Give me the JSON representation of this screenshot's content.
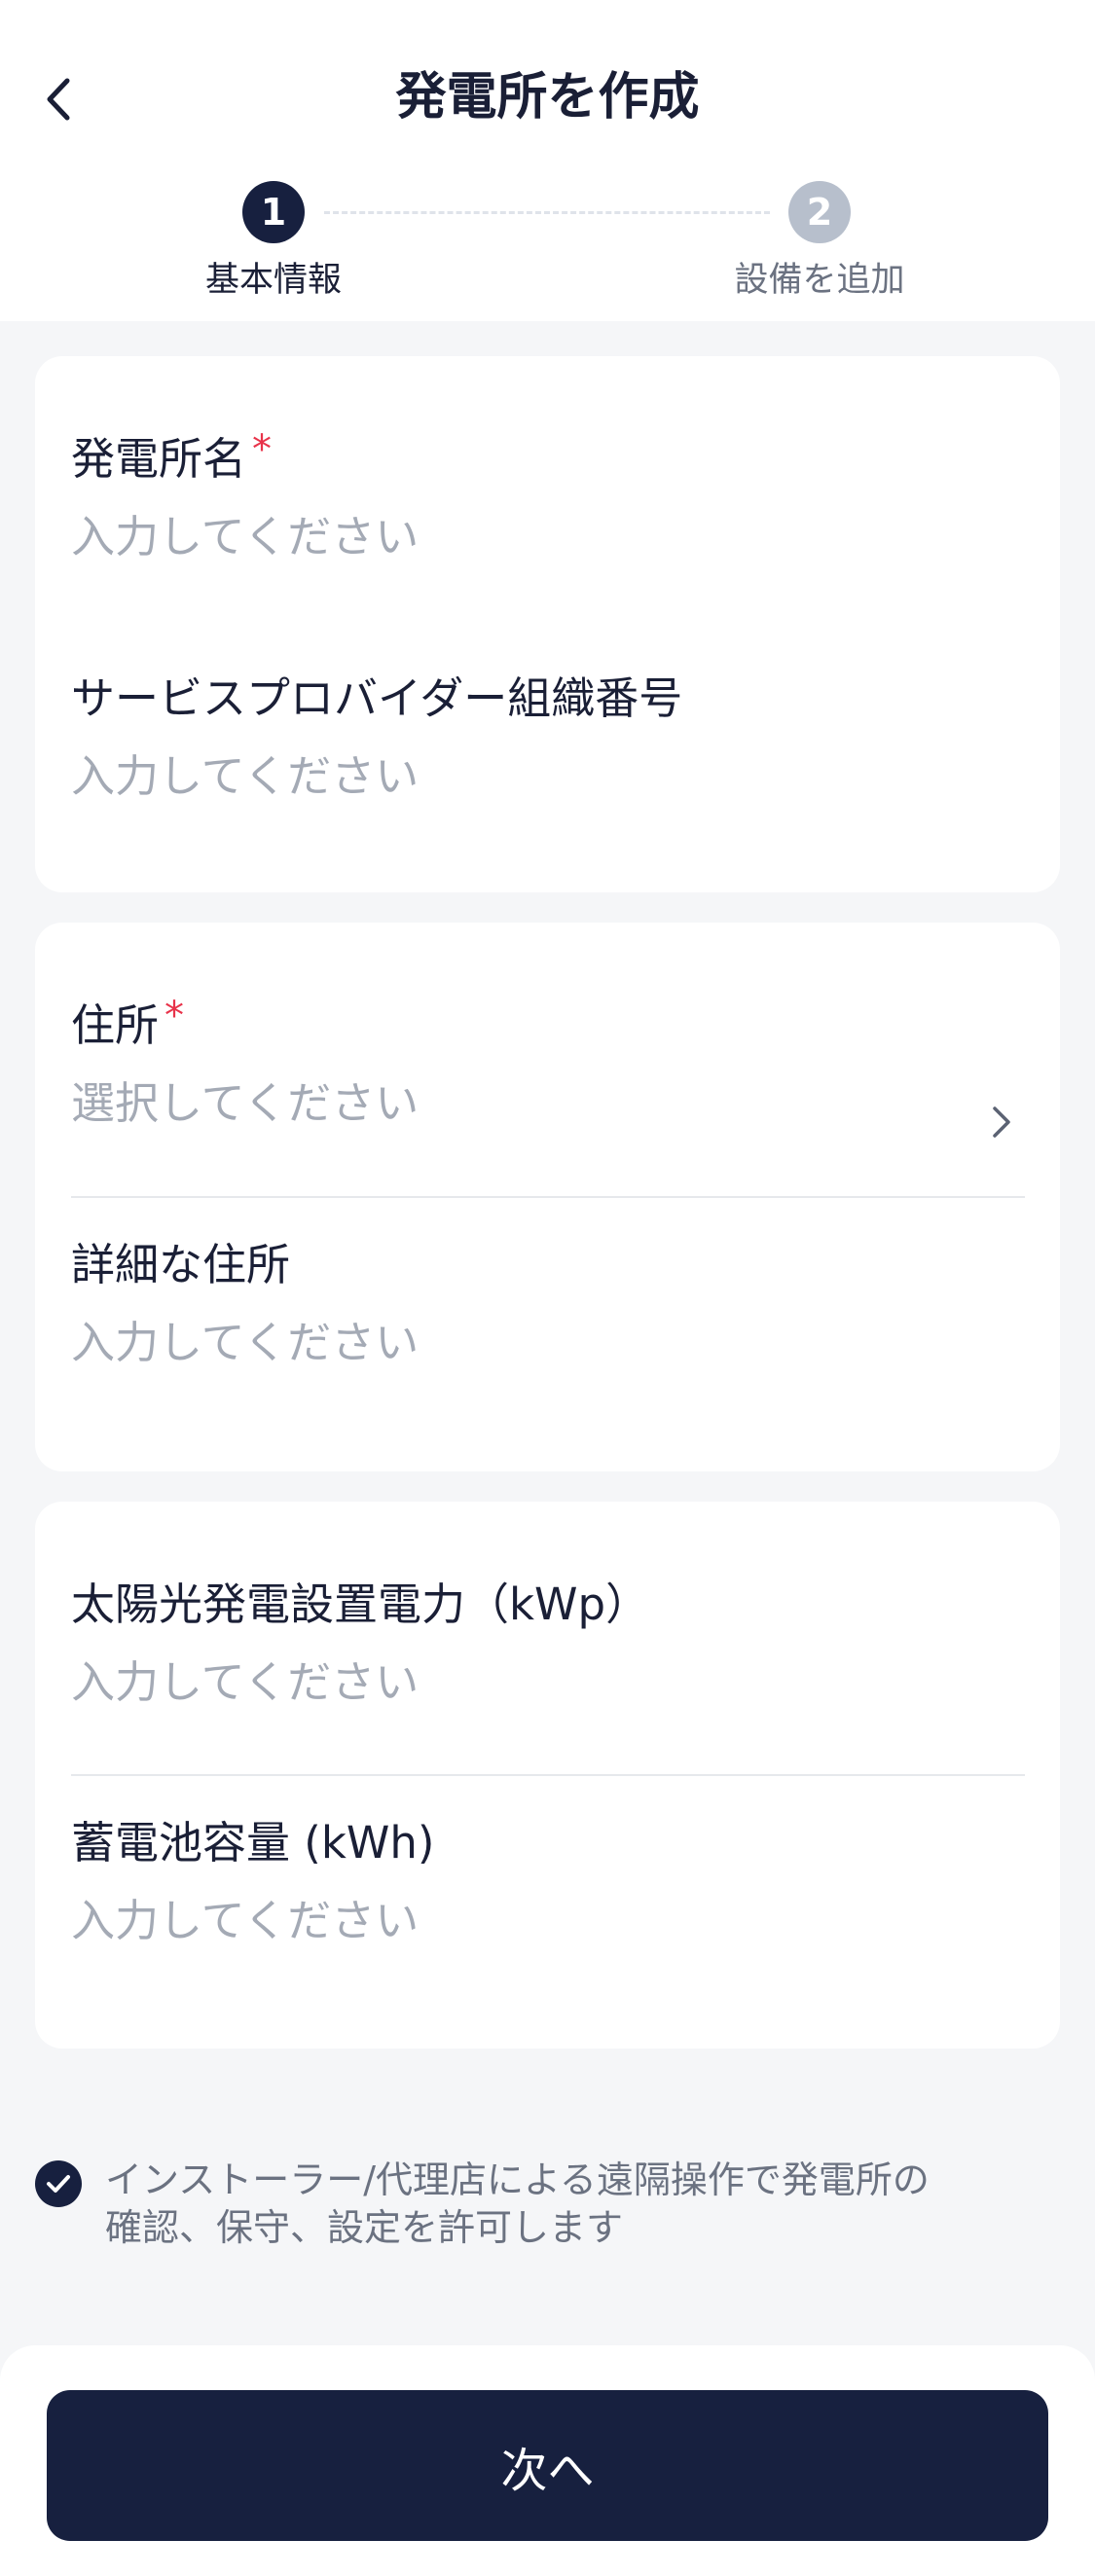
{
  "header": {
    "title": "発電所を作成",
    "back_icon": "chevron-left-icon"
  },
  "stepper": {
    "steps": [
      {
        "number": "1",
        "label": "基本情報",
        "state": "active",
        "color": "#17203f"
      },
      {
        "number": "2",
        "label": "設備を追加",
        "state": "inactive",
        "color": "#b7bfcc"
      }
    ]
  },
  "form": {
    "plant_name": {
      "label": "発電所名",
      "required_mark": "*",
      "placeholder": "入力してください",
      "value": ""
    },
    "provider_org": {
      "label": "サービスプロバイダー組織番号",
      "placeholder": "入力してください",
      "value": ""
    },
    "address": {
      "label": "住所",
      "required_mark": "*",
      "placeholder": "選択してください"
    },
    "detail_address": {
      "label": "詳細な住所",
      "placeholder": "入力してください",
      "value": ""
    },
    "pv_capacity": {
      "label": "太陽光発電設置電力（kWp）",
      "placeholder": "入力してください",
      "value": ""
    },
    "battery_capacity": {
      "label": "蓄電池容量 (kWh)",
      "placeholder": "入力してください",
      "value": ""
    }
  },
  "consent": {
    "checked": true,
    "line1": "インストーラー/代理店による遠隔操作で発電所の",
    "line2": "確認、保守、設定を許可します"
  },
  "footer": {
    "next_label": "次へ"
  },
  "colors": {
    "primary": "#17203f",
    "required": "#e8334a",
    "placeholder": "#a4aab5",
    "background": "#f5f6f8"
  }
}
